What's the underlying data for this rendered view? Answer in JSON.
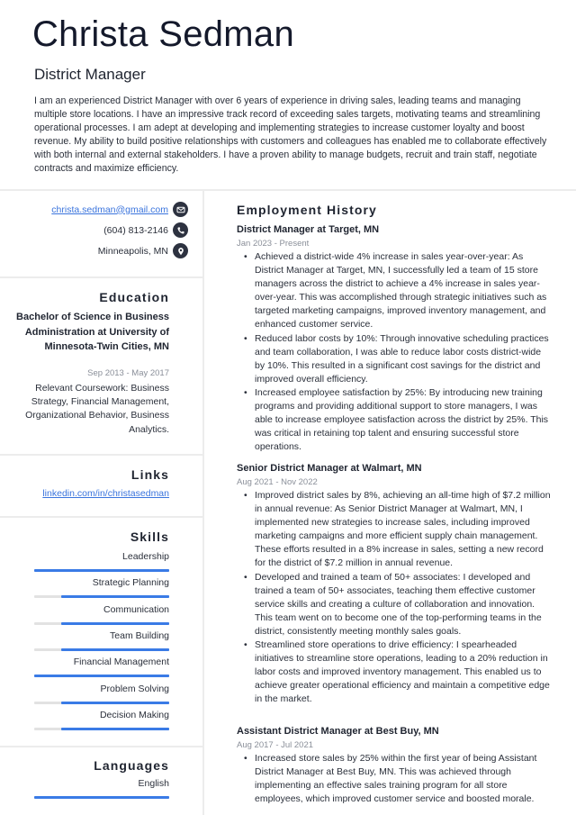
{
  "header": {
    "name": "Christa Sedman",
    "role": "District Manager",
    "summary": "I am an experienced District Manager with over 6 years of experience in driving sales, leading teams and managing multiple store locations. I have an impressive track record of exceeding sales targets, motivating teams and streamlining operational processes. I am adept at developing and implementing strategies to increase customer loyalty and boost revenue. My ability to build positive relationships with customers and colleagues has enabled me to collaborate effectively with both internal and external stakeholders. I have a proven ability to manage budgets, recruit and train staff, negotiate contracts and maximize efficiency."
  },
  "contact": {
    "email": "christa.sedman@gmail.com",
    "phone": "(604) 813-2146",
    "location": "Minneapolis, MN",
    "icons": [
      "envelope-icon",
      "phone-icon",
      "map-pin-icon"
    ]
  },
  "education": {
    "title": "Education",
    "degree": "Bachelor of Science in Business Administration at University of Minnesota-Twin Cities, MN",
    "dates": "Sep 2013 - May 2017",
    "coursework": "Relevant Coursework: Business Strategy, Financial Management, Organizational Behavior, Business Analytics."
  },
  "links": {
    "title": "Links",
    "items": [
      "linkedin.com/in/christasedman"
    ]
  },
  "skills": {
    "title": "Skills",
    "items": [
      {
        "label": "Leadership",
        "level_percent": 100
      },
      {
        "label": "Strategic Planning",
        "level_percent": 80
      },
      {
        "label": "Communication",
        "level_percent": 80
      },
      {
        "label": "Team Building",
        "level_percent": 80
      },
      {
        "label": "Financial Management",
        "level_percent": 100
      },
      {
        "label": "Problem Solving",
        "level_percent": 80
      },
      {
        "label": "Decision Making",
        "level_percent": 80
      }
    ]
  },
  "languages": {
    "title": "Languages",
    "items": [
      {
        "label": "English",
        "level_percent": 100
      }
    ]
  },
  "employment": {
    "title": "Employment History",
    "jobs": [
      {
        "title": "District Manager at Target, MN",
        "dates": "Jan 2023 - Present",
        "bullets": [
          "Achieved a district-wide 4% increase in sales year-over-year: As District Manager at Target, MN, I successfully led a team of 15 store managers across the district to achieve a 4% increase in sales year-over-year. This was accomplished through strategic initiatives such as targeted marketing campaigns, improved inventory management, and enhanced customer service.",
          "Reduced labor costs by 10%: Through innovative scheduling practices and team collaboration, I was able to reduce labor costs district-wide by 10%. This resulted in a significant cost savings for the district and improved overall efficiency.",
          "Increased employee satisfaction by 25%: By introducing new training programs and providing additional support to store managers, I was able to increase employee satisfaction across the district by 25%. This was critical in retaining top talent and ensuring successful store operations."
        ]
      },
      {
        "title": "Senior District Manager at Walmart, MN",
        "dates": "Aug 2021 - Nov 2022",
        "bullets": [
          "Improved district sales by 8%, achieving an all-time high of $7.2 million in annual revenue: As Senior District Manager at Walmart, MN, I implemented new strategies to increase sales, including improved marketing campaigns and more efficient supply chain management. These efforts resulted in a 8% increase in sales, setting a new record for the district of $7.2 million in annual revenue.",
          "Developed and trained a team of 50+ associates: I developed and trained a team of 50+ associates, teaching them effective customer service skills and creating a culture of collaboration and innovation. This team went on to become one of the top-performing teams in the district, consistently meeting monthly sales goals.",
          "Streamlined store operations to drive efficiency: I spearheaded initiatives to streamline store operations, leading to a 20% reduction in labor costs and improved inventory management. This enabled us to achieve greater operational efficiency and maintain a competitive edge in the market."
        ]
      },
      {
        "title": "Assistant District Manager at Best Buy, MN",
        "dates": "Aug 2017 - Jul 2021",
        "bullets": [
          "Increased store sales by 25% within the first year of being Assistant District Manager at Best Buy, MN. This was achieved through implementing an effective sales training program for all store employees, which improved customer service and boosted morale."
        ]
      }
    ]
  }
}
